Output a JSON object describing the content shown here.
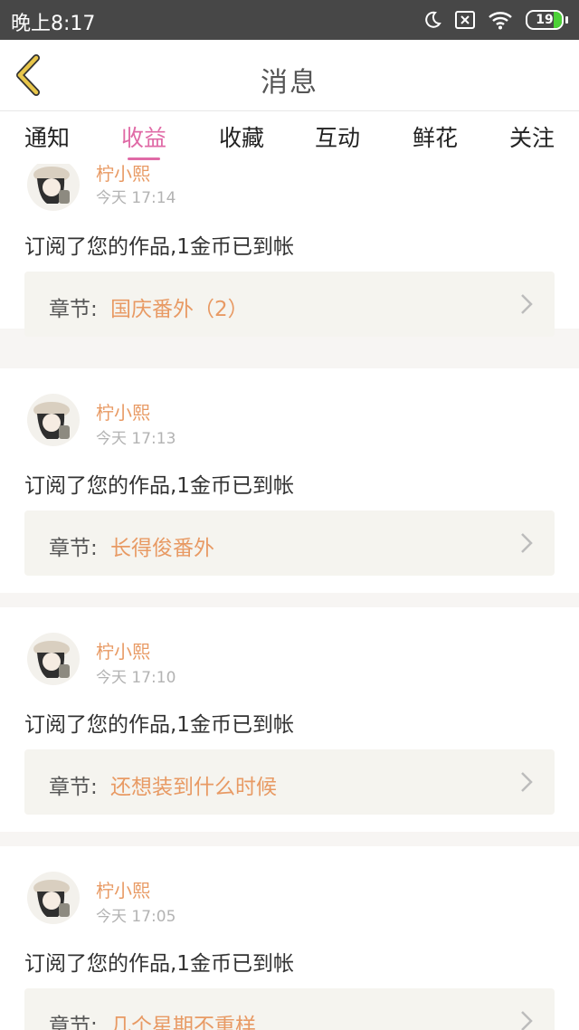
{
  "status_bar": {
    "time": "晚上8:17",
    "battery_level": "19",
    "icons": [
      "moon-icon",
      "sim-off-icon",
      "wifi-icon",
      "battery-icon"
    ]
  },
  "header": {
    "title": "消息",
    "back_icon": "chevron-left-icon"
  },
  "tabs": [
    {
      "label": "通知"
    },
    {
      "label": "收益"
    },
    {
      "label": "收藏"
    },
    {
      "label": "互动"
    },
    {
      "label": "鲜花"
    },
    {
      "label": "关注"
    }
  ],
  "active_tab": "收益",
  "colors": {
    "accent": "#e06aa6",
    "author": "#e89a64",
    "chapter": "#e89a64",
    "back": "#e8c64a"
  },
  "messages": [
    {
      "author": "柠小熙",
      "time": "今天 17:14",
      "text": "订阅了您的作品,1金币已到帐",
      "chapter_label": "章节:",
      "chapter": "国庆番外（2）"
    },
    {
      "author": "柠小熙",
      "time": "今天 17:13",
      "text": "订阅了您的作品,1金币已到帐",
      "chapter_label": "章节:",
      "chapter": "长得俊番外"
    },
    {
      "author": "柠小熙",
      "time": "今天 17:10",
      "text": "订阅了您的作品,1金币已到帐",
      "chapter_label": "章节:",
      "chapter": "还想装到什么时候"
    },
    {
      "author": "柠小熙",
      "time": "今天 17:05",
      "text": "订阅了您的作品,1金币已到帐",
      "chapter_label": "章节:",
      "chapter": "几个星期不重样"
    }
  ]
}
